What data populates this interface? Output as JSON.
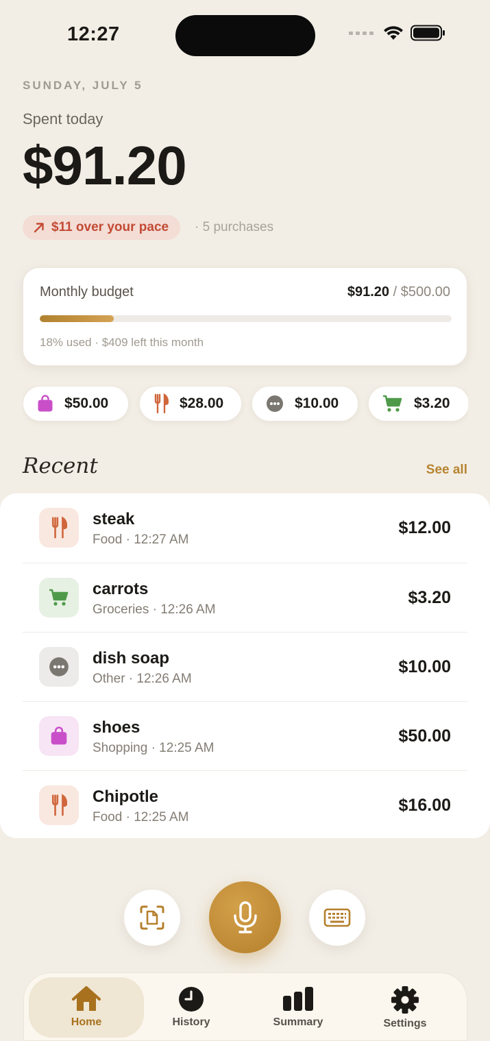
{
  "status_bar": {
    "time": "12:27"
  },
  "header": {
    "date": "SUNDAY, JULY 5",
    "spent_label": "Spent today",
    "spent_amount": "$91.20",
    "pace_text": "$11 over your pace",
    "purchases_text": "· 5 purchases"
  },
  "budget": {
    "title": "Monthly budget",
    "spent": "$91.20",
    "separator": "/",
    "total": "$500.00",
    "used_fraction": 0.18,
    "note": "18% used · $409 left this month"
  },
  "category_chips": [
    {
      "icon": "shopping-bag-icon",
      "amount": "$50.00",
      "color": "#c94fc9"
    },
    {
      "icon": "fork-knife-icon",
      "amount": "$28.00",
      "color": "#d0663c"
    },
    {
      "icon": "more-dots-icon",
      "amount": "$10.00",
      "color": "#7a7670"
    },
    {
      "icon": "cart-icon",
      "amount": "$3.20",
      "color": "#4f9a4a"
    }
  ],
  "recent": {
    "title": "Recent",
    "see_all": "See all",
    "items": [
      {
        "name": "steak",
        "meta": "Food · 12:27 AM",
        "amount": "$12.00",
        "icon": "fork-knife-icon"
      },
      {
        "name": "carrots",
        "meta": "Groceries · 12:26 AM",
        "amount": "$3.20",
        "icon": "cart-icon"
      },
      {
        "name": "dish soap",
        "meta": "Other · 12:26 AM",
        "amount": "$10.00",
        "icon": "more-dots-icon"
      },
      {
        "name": "shoes",
        "meta": "Shopping · 12:25 AM",
        "amount": "$50.00",
        "icon": "shopping-bag-icon"
      },
      {
        "name": "Chipotle",
        "meta": "Food · 12:25 AM",
        "amount": "$16.00",
        "icon": "fork-knife-icon"
      }
    ]
  },
  "actions": {
    "left": "scan-receipt-icon",
    "center": "microphone-icon",
    "right": "keyboard-icon"
  },
  "tabs": [
    {
      "label": "Home",
      "icon": "home-icon",
      "active": true
    },
    {
      "label": "History",
      "icon": "clock-icon",
      "active": false
    },
    {
      "label": "Summary",
      "icon": "bar-chart-icon",
      "active": false
    },
    {
      "label": "Settings",
      "icon": "gear-icon",
      "active": false
    }
  ],
  "colors": {
    "accent": "#b78430",
    "over_pace": "#c34a35",
    "background": "#f2eee6"
  }
}
